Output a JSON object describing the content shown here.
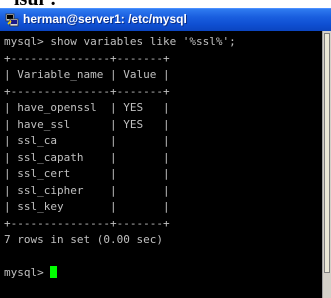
{
  "fragment_text": "lsul´.",
  "window": {
    "title": "herman@server1: /etc/mysql",
    "app_icon": "putty-icon"
  },
  "terminal": {
    "lines": [
      "mysql> show variables like '%ssl%';",
      "+---------------+-------+",
      "| Variable_name | Value |",
      "+---------------+-------+",
      "| have_openssl  | YES   |",
      "| have_ssl      | YES   |",
      "| ssl_ca        |       |",
      "| ssl_capath    |       |",
      "| ssl_cert      |       |",
      "| ssl_cipher    |       |",
      "| ssl_key       |       |",
      "+---------------+-------+",
      "7 rows in set (0.00 sec)",
      "",
      "mysql> "
    ],
    "cursor_color": "#00ff00",
    "text_color": "#c0c0c0"
  }
}
